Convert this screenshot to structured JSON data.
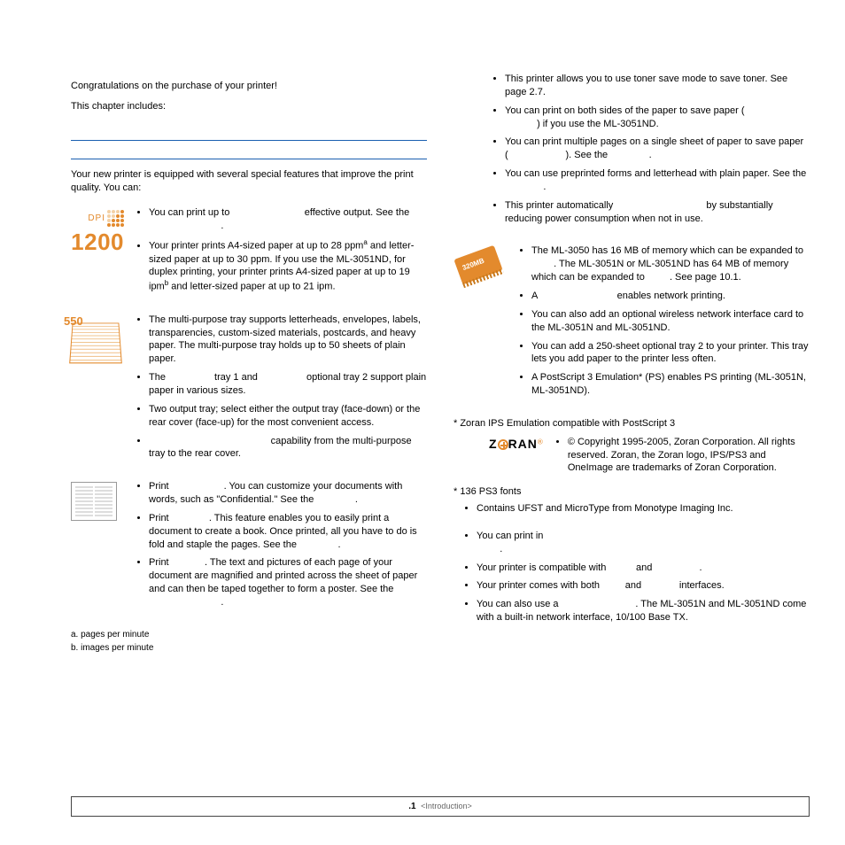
{
  "intro": {
    "congrats": "Congratulations on the purchase of your printer!",
    "includes": "This chapter includes:"
  },
  "lead": "Your new printer is equipped with several special features that improve the print quality. You can:",
  "dpiNumber": "1200",
  "dpiLabel": "DPI",
  "paperStackLabel": "550",
  "chipLabel": "320MB",
  "quality": {
    "b1a": "You can print up to ",
    "b1b": " effective output. See the ",
    "b1c": ".",
    "b2a": "Your printer prints A4-sized paper at up to 28 ppm",
    "b2sup_a": "a",
    "b2b": " and letter-sized paper at up to 30 ppm. If you use the ML-3051ND, for duplex printing, your printer prints A4-sized paper at up to 19 ipm",
    "b2sup_b": "b",
    "b2c": " and letter-sized paper at up to 21 ipm."
  },
  "paper": {
    "b1": "The multi-purpose tray supports letterheads, envelopes, labels, transparencies, custom-sized materials, postcards, and heavy paper. The multi-purpose tray holds up to 50 sheets of plain paper.",
    "b2a": "The ",
    "b2b": " tray 1 and ",
    "b2c": " optional tray 2 support plain paper in various sizes.",
    "b3": "Two output tray; select either the output tray (face-down) or the rear cover (face-up) for the most convenient access.",
    "b4a": " capability from the multi-purpose tray to the rear cover."
  },
  "docs": {
    "b1a": "Print ",
    "b1b": ". You can customize your documents with words, such as \"Confidential.\" See the ",
    "b1c": ".",
    "b2a": "Print ",
    "b2b": ". This feature enables you to easily print a document to create a book. Once printed, all you have to do is fold and staple the pages. See the ",
    "b2c": ".",
    "b3a": "Print ",
    "b3b": ". The text and pictures of each page of your document are magnified and printed across the sheet of paper and can then be taped together to form a poster. See the ",
    "b3c": "."
  },
  "footnotes": {
    "a": "a. pages per minute",
    "b": "b. images per minute"
  },
  "rightTop": {
    "b1": "This printer allows you to use toner save mode to save toner. See page 2.7.",
    "b2a": "You can print on both sides of the paper to save paper (",
    "b2b": ") if you use the ML-3051ND.",
    "b3a": "You can print multiple pages on a single sheet of paper to save paper (",
    "b3b": "). See the ",
    "b3c": ".",
    "b4a": "You can use preprinted forms and letterhead with plain paper. See the ",
    "b4b": ".",
    "b5a": "This printer automatically ",
    "b5b": " by substantially reducing power consumption when not in use."
  },
  "expand": {
    "b1a": "The ML-3050 has 16 MB of memory which can be expanded to ",
    "b1b": ". The ML-3051N or ML-3051ND has 64 MB of memory which can be expanded to ",
    "b1c": ". See page 10.1.",
    "b2a": "A ",
    "b2b": " enables network printing.",
    "b3": "You can also add an optional wireless network interface card to the ML-3051N and ML-3051ND.",
    "b4": "You can add a 250-sheet optional tray 2 to your printer. This tray lets you add paper to the printer less often.",
    "b5": "A PostScript 3 Emulation* (PS) enables PS printing (ML-3051N, ML-3051ND)."
  },
  "zoran": {
    "compat": "* Zoran IPS Emulation compatible with PostScript 3",
    "brand": "Z   RAN",
    "copyright": "© Copyright 1995-2005, Zoran Corporation. All rights reserved. Zoran, the Zoran logo, IPS/PS3 and OneImage are trademarks of Zoran Corporation.",
    "fonts": "* 136 PS3 fonts",
    "ufst": "Contains UFST and MicroType from Monotype Imaging Inc."
  },
  "env": {
    "b1a": "You can print in ",
    "b1b": ".",
    "b2a": "Your printer is compatible with ",
    "b2b": " and ",
    "b2c": ".",
    "b3a": "Your printer comes with both ",
    "b3b": " and ",
    "b3c": " interfaces.",
    "b4a": "You can also use a ",
    "b4b": ". The ML-3051N and ML-3051ND come with a built-in network interface, 10/100 Base TX."
  },
  "footer": {
    "page": ".1",
    "chapter": "<Introduction>"
  }
}
